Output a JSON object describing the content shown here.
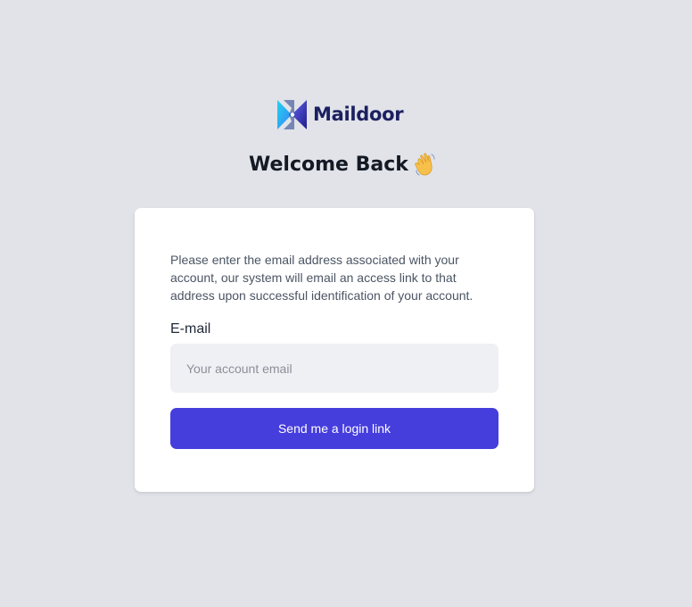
{
  "brand": {
    "name": "Maildoor",
    "logo_icon": "maildoor-logo-icon",
    "colors": {
      "logo_gradient_start": "#22d3ee",
      "logo_gradient_end": "#4f46e5",
      "name": "#1c2060"
    }
  },
  "header": {
    "title": "Welcome Back",
    "emoji_icon": "waving-hand-icon"
  },
  "login_card": {
    "description": "Please enter the email address associated with your account, our system will email an access link to that address upon successful identification of your account.",
    "email_label": "E-mail",
    "email_value": "",
    "email_placeholder": "Your account email",
    "submit_label": "Send me a login link"
  },
  "colors": {
    "background": "#e1e3e9",
    "card": "#ffffff",
    "input_background": "#eff0f3",
    "accent": "#463ddd"
  }
}
